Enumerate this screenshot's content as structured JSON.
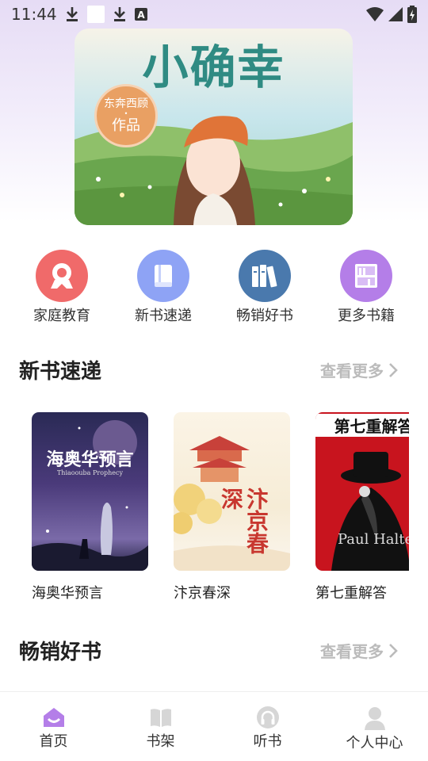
{
  "status_bar": {
    "time": "11:44"
  },
  "banner": {
    "title": "小确幸",
    "stamp_author": "东奔西顾",
    "stamp_work": "作品"
  },
  "categories": [
    {
      "label": "家庭教育",
      "color": "#f06a6a",
      "icon": "award-icon"
    },
    {
      "label": "新书速递",
      "color": "#8ea3f5",
      "icon": "book-icon"
    },
    {
      "label": "畅销好书",
      "color": "#4a79ad",
      "icon": "books-icon"
    },
    {
      "label": "更多书籍",
      "color": "#b47ee8",
      "icon": "bookshelf-icon"
    }
  ],
  "sections": {
    "new_books": {
      "title": "新书速递",
      "more": "查看更多"
    },
    "bestsellers": {
      "title": "畅销好书",
      "more": "查看更多"
    }
  },
  "books": [
    {
      "title": "海奥华预言",
      "cover_title": "海奥华预言",
      "cover_sub": "Thiaoouba Prophecy"
    },
    {
      "title": "汴京春深",
      "cover_title": "汴京春深"
    },
    {
      "title": "第七重解答",
      "cover_title": "第七重解答",
      "cover_sub": "Paul Halter"
    }
  ],
  "tabbar": [
    {
      "label": "首页",
      "active": true
    },
    {
      "label": "书架",
      "active": false
    },
    {
      "label": "听书",
      "active": false
    },
    {
      "label": "个人中心",
      "active": false
    }
  ],
  "colors": {
    "accent": "#b47ee8",
    "tab_inactive": "#d6d6d6"
  }
}
